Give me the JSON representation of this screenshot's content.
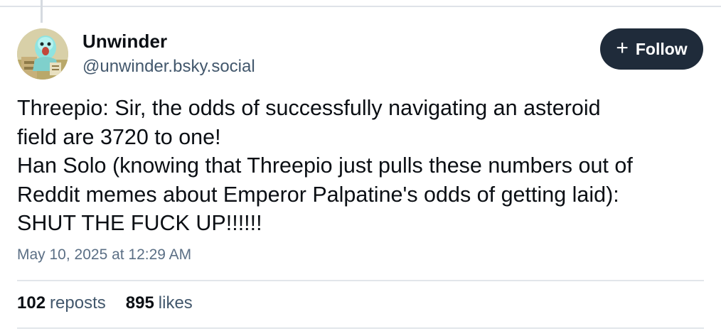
{
  "author": {
    "display_name": "Unwinder",
    "handle": "@unwinder.bsky.social",
    "avatar_icon": "avatar-cartoon-icon"
  },
  "follow_button": {
    "icon": "+",
    "label": "Follow"
  },
  "post": {
    "lines": [
      "Threepio: Sir, the odds of successfully navigating an asteroid",
      "field are 3720 to one!",
      "Han Solo (knowing that Threepio just pulls these numbers out of",
      "Reddit memes about Emperor Palpatine's odds of getting laid):",
      "SHUT THE FUCK UP!!!!!!"
    ],
    "timestamp": "May 10, 2025 at 12:29 AM"
  },
  "stats": {
    "reposts_count": "102",
    "reposts_label": "reposts",
    "likes_count": "895",
    "likes_label": "likes"
  },
  "colors": {
    "follow_bg": "#1f2b3a",
    "handle": "#42576c",
    "timestamp": "#5b6f85"
  }
}
